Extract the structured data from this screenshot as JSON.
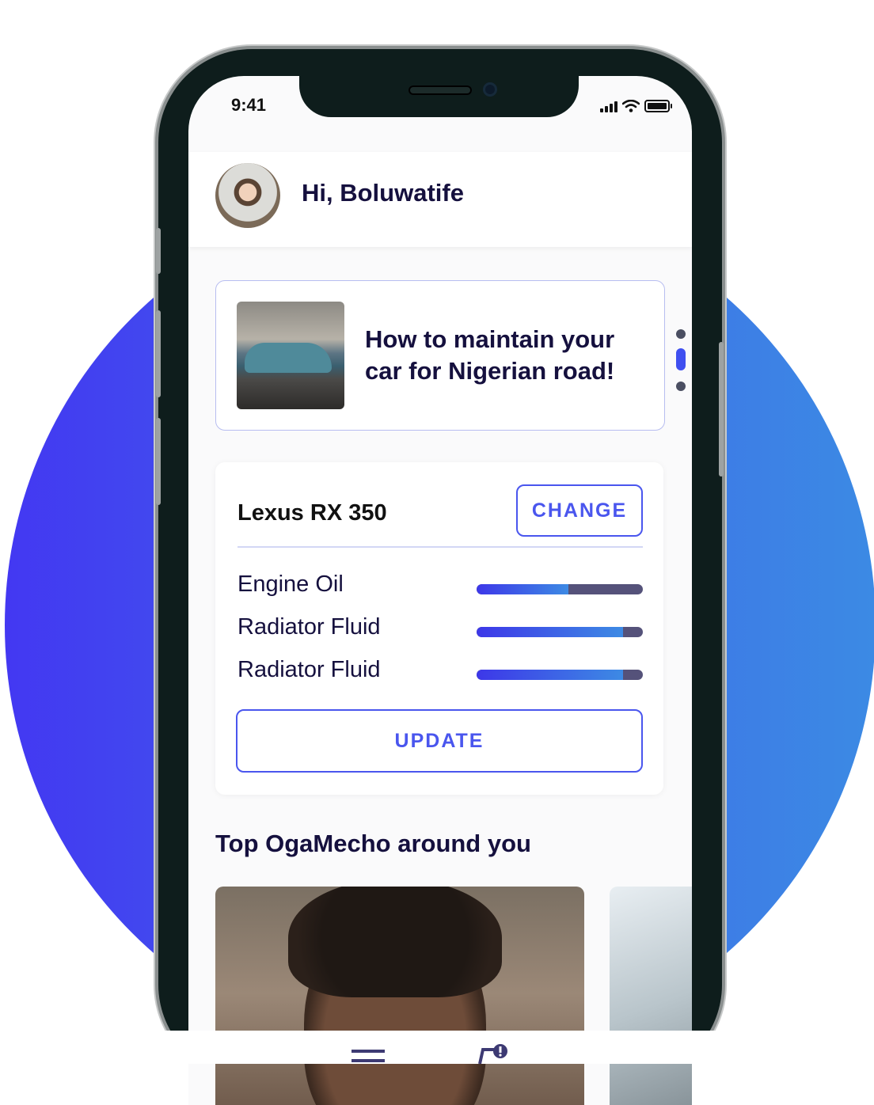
{
  "status_bar": {
    "time": "9:41"
  },
  "header": {
    "greeting": "Hi, Boluwatife"
  },
  "article": {
    "title": "How to maintain your car for Nigerian road!"
  },
  "car": {
    "name": "Lexus RX 350",
    "change_label": "CHANGE",
    "update_label": "UPDATE",
    "fluids": [
      {
        "label": "Engine Oil",
        "level": 0.55
      },
      {
        "label": "Radiator Fluid",
        "level": 0.88
      },
      {
        "label": "Radiator Fluid",
        "level": 0.88
      }
    ]
  },
  "mechanics": {
    "section_title": "Top OgaMecho around you"
  },
  "colors": {
    "accent": "#4a56ee",
    "bar_track": "#55527a",
    "text_dark": "#15103e"
  },
  "icons": [
    "signal-icon",
    "wifi-icon",
    "battery-icon",
    "menu-icon",
    "notification-icon"
  ]
}
